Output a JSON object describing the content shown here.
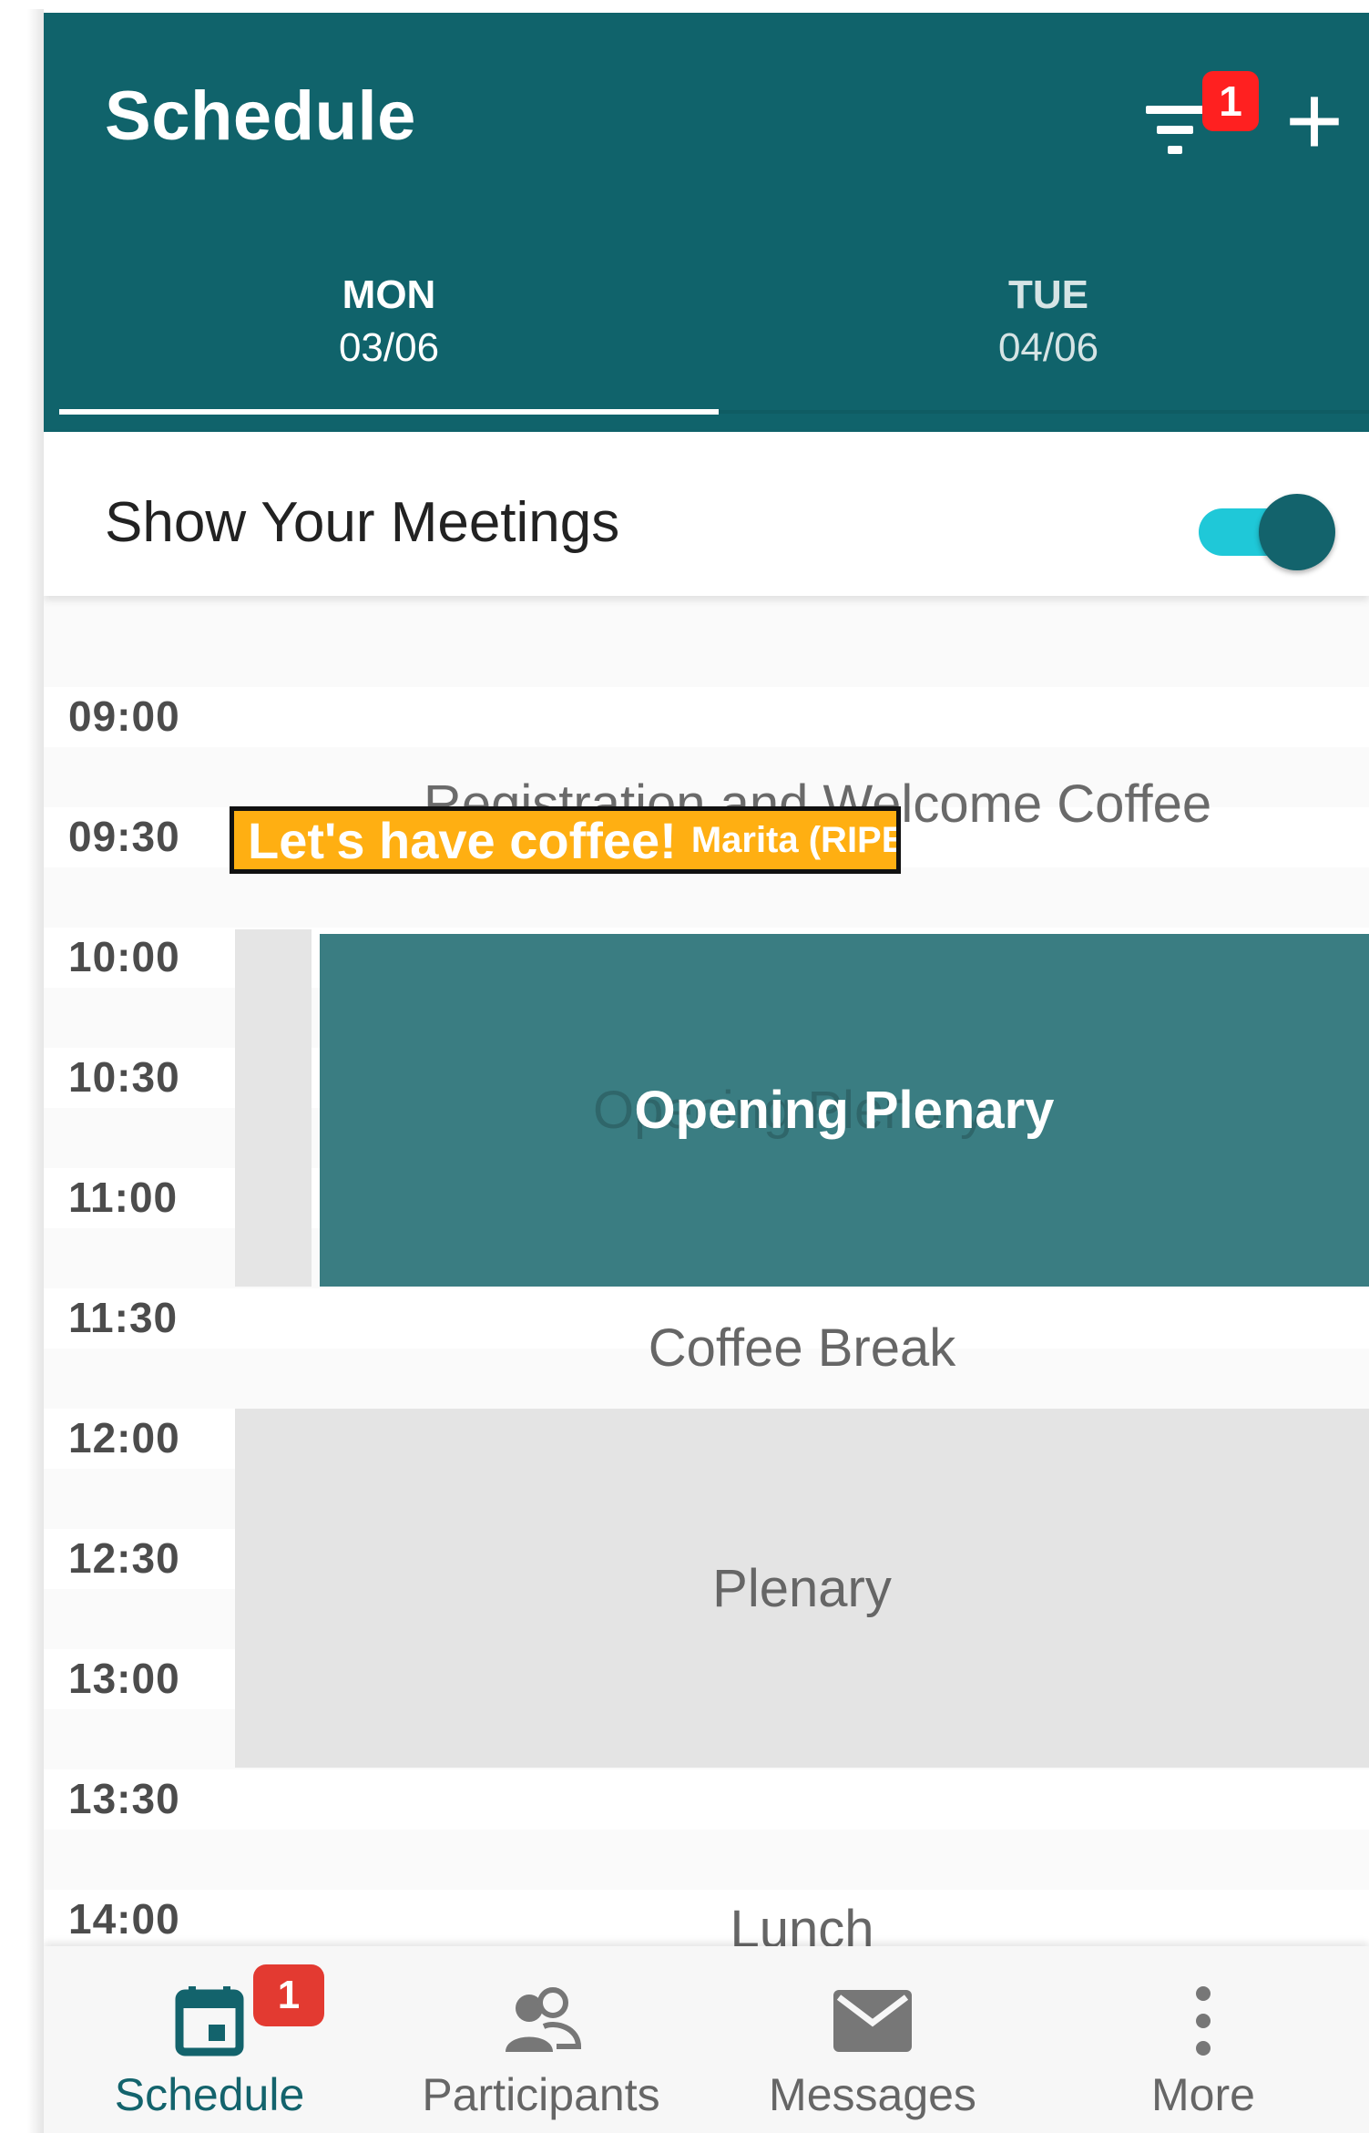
{
  "header": {
    "title": "Schedule",
    "filter_badge": "1",
    "add_label": "+"
  },
  "days": [
    {
      "dow": "MON",
      "date": "03/06",
      "selected": true
    },
    {
      "dow": "TUE",
      "date": "04/06",
      "selected": false
    }
  ],
  "toggle": {
    "label": "Show Your Meetings",
    "on": true
  },
  "times": [
    "09:00",
    "09:30",
    "10:00",
    "10:30",
    "11:00",
    "11:30",
    "12:00",
    "12:30",
    "13:00",
    "13:30",
    "14:00"
  ],
  "events": {
    "registration": "Registration and Welcome Coffee",
    "coffee_note_title": "Let's have coffee!",
    "coffee_note_who": "Marita (RIPE NCC)",
    "opening": "Opening Plenary",
    "coffee_break": "Coffee Break",
    "plenary": "Plenary",
    "lunch": "Lunch"
  },
  "nav": {
    "schedule": "Schedule",
    "schedule_badge": "1",
    "participants": "Participants",
    "messages": "Messages",
    "more": "More"
  },
  "colors": {
    "header": "#10636b",
    "accent": "#1fc8d8",
    "opening_event": "#3a7d82",
    "note": "#ffaf12",
    "badge": "#ff2020"
  }
}
